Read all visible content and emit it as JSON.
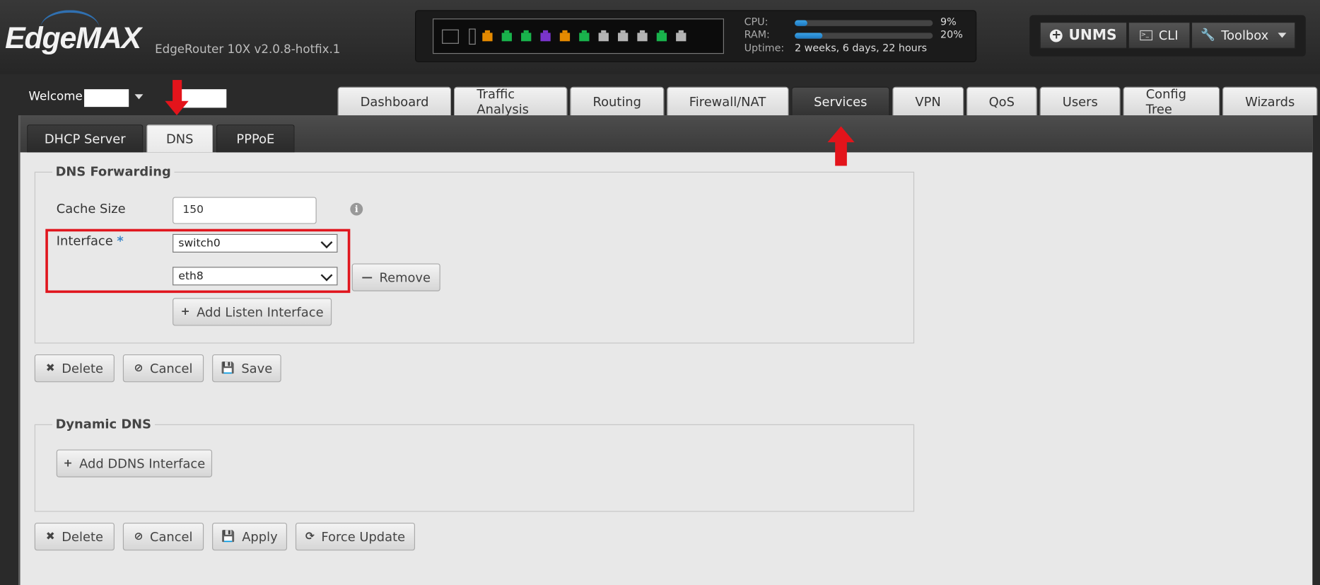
{
  "header": {
    "logo_text": "EdgeMAX",
    "model": "EdgeRouter 10X v2.0.8-hotfix.1",
    "stats": {
      "cpu_label": "CPU:",
      "cpu_value": "9%",
      "cpu_fraction": 0.09,
      "ram_label": "RAM:",
      "ram_value": "20%",
      "ram_fraction": 0.2,
      "uptime_label": "Uptime:",
      "uptime_value": "2 weeks, 6 days, 22 hours"
    },
    "port_colors": [
      "#e58a00",
      "#19b34c",
      "#19b34c",
      "#7a34cc",
      "#e58a00",
      "#19b34c",
      "#b4b4b4",
      "#b4b4b4",
      "#b4b4b4",
      "#19b34c",
      "#b4b4b4"
    ],
    "tools": {
      "unms": "UNMS",
      "cli": "CLI",
      "toolbox": "Toolbox"
    }
  },
  "user": {
    "welcome": "Welcome"
  },
  "main_tabs": [
    "Dashboard",
    "Traffic Analysis",
    "Routing",
    "Firewall/NAT",
    "Services",
    "VPN",
    "QoS",
    "Users",
    "Config Tree",
    "Wizards"
  ],
  "active_main_tab": "Services",
  "sub_tabs": [
    "DHCP Server",
    "DNS",
    "PPPoE"
  ],
  "active_sub_tab": "DNS",
  "dns_forwarding": {
    "legend": "DNS Forwarding",
    "cache_label": "Cache Size",
    "cache_value": "150",
    "interface_label": "Interface",
    "required_mark": "*",
    "interfaces": [
      "switch0",
      "eth8"
    ],
    "remove_label": "Remove",
    "add_listen_label": "Add Listen Interface"
  },
  "forwarding_actions": {
    "delete": "Delete",
    "cancel": "Cancel",
    "save": "Save"
  },
  "dynamic_dns": {
    "legend": "Dynamic DNS",
    "add_label": "Add DDNS Interface"
  },
  "ddns_actions": {
    "delete": "Delete",
    "cancel": "Cancel",
    "apply": "Apply",
    "force_update": "Force Update"
  },
  "colors": {
    "annotation_red": "#e3141b",
    "accent_blue": "#2f7fd0"
  }
}
